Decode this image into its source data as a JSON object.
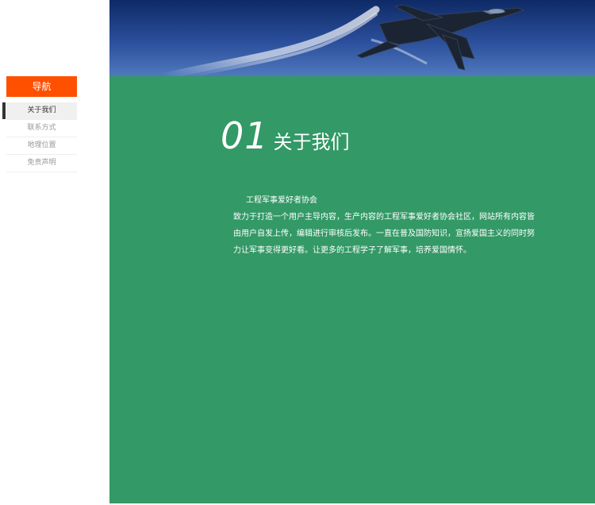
{
  "sidebar": {
    "nav_title": "导航",
    "items": [
      {
        "label": "关于我们",
        "active": true
      },
      {
        "label": "联系方式",
        "active": false
      },
      {
        "label": "地理位置",
        "active": false
      },
      {
        "label": "免责声明",
        "active": false
      }
    ]
  },
  "banner": {
    "icon": "fighter-jet-image"
  },
  "main": {
    "section_number": "01",
    "section_title": "关于我们",
    "org_name": "工程军事爱好者协会",
    "description": "致力于打造一个用户主导内容，生产内容的工程军事爱好者协会社区，网站所有内容皆由用户自发上传，编辑进行审核后发布。一直在普及国防知识，宣扬爱国主义的同时努力让军事变得更好看。让更多的工程学子了解军事，培养爱国情怀。"
  },
  "colors": {
    "accent": "#ff5000",
    "content_bg": "#339966"
  }
}
